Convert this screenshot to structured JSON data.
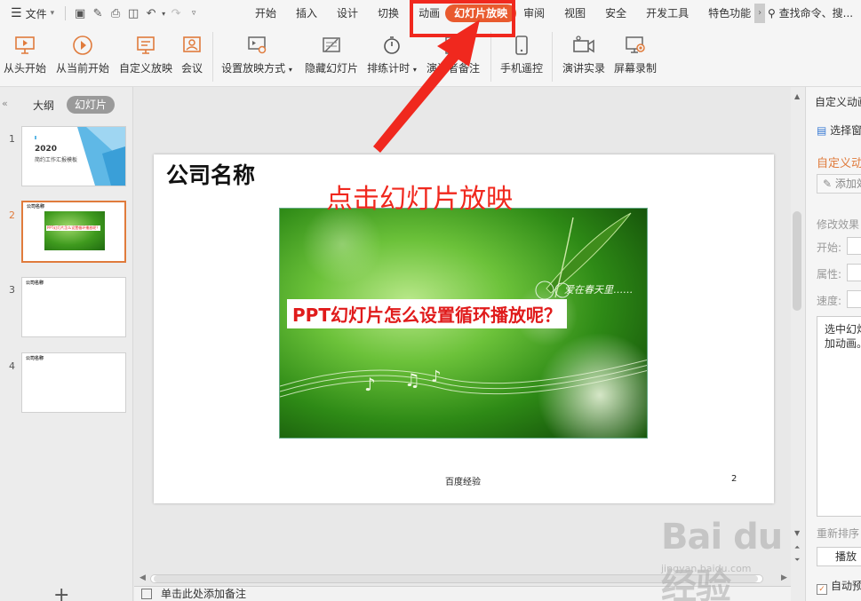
{
  "menubar": {
    "file_label": "文件",
    "tabs": [
      {
        "label": "开始"
      },
      {
        "label": "插入"
      },
      {
        "label": "设计"
      },
      {
        "label": "切换"
      },
      {
        "label": "动画"
      },
      {
        "label": "幻灯片放映",
        "active": true
      },
      {
        "label": "审阅"
      },
      {
        "label": "视图"
      },
      {
        "label": "安全"
      },
      {
        "label": "开发工具"
      },
      {
        "label": "特色功能"
      }
    ],
    "search_label": "查找命令、搜..."
  },
  "ribbon": {
    "from_start": "从头开始",
    "from_current": "从当前开始",
    "custom_show": "自定义放映",
    "meeting": "会议",
    "setup_show": "设置放映方式",
    "hide_slide": "隐藏幻灯片",
    "rehearse": "排练计时",
    "presenter_notes": "演讲者备注",
    "phone_remote": "手机遥控",
    "record_show": "演讲实录",
    "screen_record": "屏幕录制"
  },
  "left_panel": {
    "outline_tab": "大纲",
    "slides_tab": "幻灯片",
    "thumbs": [
      {
        "num": "1",
        "year": "2020",
        "line1": "简约工作汇报模板"
      },
      {
        "num": "2",
        "title": "公司名称",
        "caption": "PPT幻灯片怎么设置循环播放呢？"
      },
      {
        "num": "3",
        "title": "公司名称"
      },
      {
        "num": "4",
        "title": "公司名称"
      }
    ]
  },
  "slide": {
    "title": "公司名称",
    "caption": "PPT幻灯片怎么设置循环播放呢？",
    "footer": "百度经验",
    "page_number": "2",
    "photo_text": "爱在春天里……"
  },
  "annotation": "点击幻灯片放映",
  "notes_placeholder": "单击此处添加备注",
  "right_panel": {
    "title": "自定义动画",
    "select_pane": "选择窗格",
    "custom_anim": "自定义动画",
    "add_effect": "添加效果",
    "modify_effect": "修改效果",
    "start_label": "开始:",
    "property_label": "属性:",
    "speed_label": "速度:",
    "list_text_1": "选中幻灯",
    "list_text_2": "加动画。",
    "reorder": "重新排序",
    "play": "播放",
    "auto_preview": "自动预览"
  },
  "watermark": {
    "text": "Bai du 经验",
    "url": "jingyan.baidu.com"
  },
  "colors": {
    "accent": "#e95a2e",
    "annotation": "#f0281e",
    "caption_red": "#e01b1b"
  }
}
